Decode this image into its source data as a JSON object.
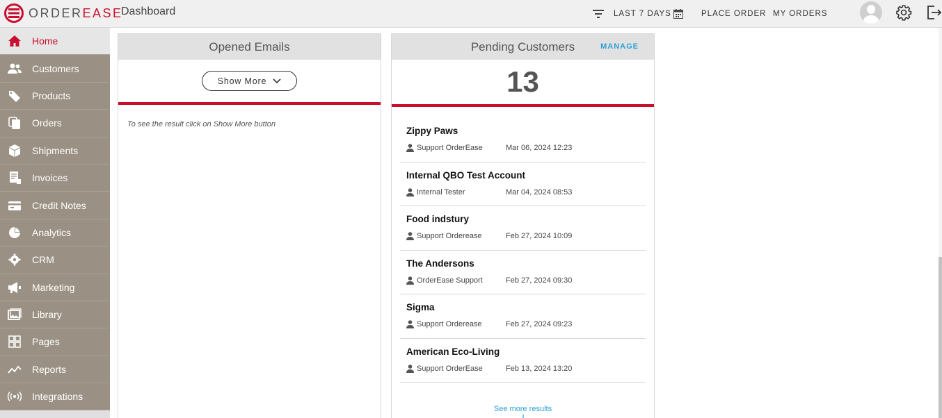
{
  "app": {
    "logo_prefix": "ORDER",
    "logo_suffix": "EASE",
    "page_title": "Dashboard",
    "accent_color": "#c8102e",
    "sidebar_color": "#9a9184",
    "link_color": "#2a9fd6"
  },
  "header": {
    "filter_label": "LAST 7 DAYS",
    "filter_icon": "filter-icon",
    "calendar_icon": "calendar-icon",
    "place_order_label": "PLACE ORDER",
    "my_orders_label": "MY ORDERS",
    "avatar_icon": "user-avatar",
    "settings_icon": "gear-icon",
    "logout_icon": "logout-icon"
  },
  "sidebar": {
    "items": [
      {
        "label": "Home",
        "icon": "home-icon",
        "active": true
      },
      {
        "label": "Customers",
        "icon": "customers-icon"
      },
      {
        "label": "Products",
        "icon": "tag-icon"
      },
      {
        "label": "Orders",
        "icon": "orders-icon"
      },
      {
        "label": "Shipments",
        "icon": "box-icon"
      },
      {
        "label": "Invoices",
        "icon": "invoice-icon"
      },
      {
        "label": "Credit Notes",
        "icon": "credit-card-icon"
      },
      {
        "label": "Analytics",
        "icon": "pie-chart-icon"
      },
      {
        "label": "CRM",
        "icon": "cog-icon"
      },
      {
        "label": "Marketing",
        "icon": "megaphone-icon"
      },
      {
        "label": "Library",
        "icon": "image-icon"
      },
      {
        "label": "Pages",
        "icon": "grid-icon"
      },
      {
        "label": "Reports",
        "icon": "trend-icon"
      },
      {
        "label": "Integrations",
        "icon": "broadcast-icon"
      }
    ]
  },
  "opened_emails": {
    "title": "Opened Emails",
    "show_more_label": "Show More",
    "hint": "To see the result click on Show More button"
  },
  "pending_customers": {
    "title": "Pending Customers",
    "manage_label": "MANAGE",
    "count": "13",
    "see_more_label": "See more results",
    "items": [
      {
        "name": "Zippy Paws",
        "user": "Support OrderEase",
        "date": "Mar 06, 2024 12:23"
      },
      {
        "name": "Internal QBO Test Account",
        "user": "Internal Tester",
        "date": "Mar 04, 2024 08:53"
      },
      {
        "name": "Food indstury",
        "user": "Support Orderease",
        "date": "Feb 27, 2024 10:09"
      },
      {
        "name": "The Andersons",
        "user": "OrderEase Support",
        "date": "Feb 27, 2024 09:30"
      },
      {
        "name": "Sigma",
        "user": "Support Orderease",
        "date": "Feb 27, 2024 09:23"
      },
      {
        "name": "American Eco-Living",
        "user": "Support OrderEase",
        "date": "Feb 13, 2024 13:20"
      }
    ]
  }
}
